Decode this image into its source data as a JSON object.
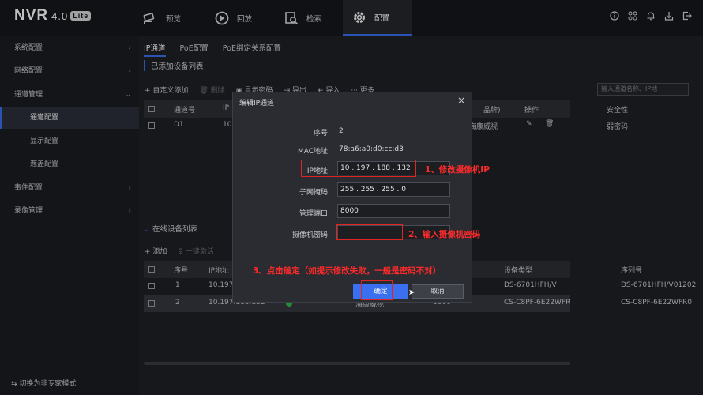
{
  "app": {
    "name": "NVR",
    "version": "4.0",
    "edition": "Lite"
  },
  "nav": [
    {
      "label": "预览",
      "icon": "camera-icon"
    },
    {
      "label": "回放",
      "icon": "playback-icon"
    },
    {
      "label": "检索",
      "icon": "search-icon"
    },
    {
      "label": "配置",
      "icon": "gear-icon",
      "active": true
    }
  ],
  "top_icons": [
    "info-icon",
    "apps-icon",
    "bell-icon",
    "download-icon",
    "logout-icon"
  ],
  "sidebar": {
    "items": [
      {
        "label": "系统配置",
        "arrow": "›"
      },
      {
        "label": "网络配置",
        "arrow": "›"
      },
      {
        "label": "通道管理",
        "arrow": "⌄"
      },
      {
        "label": "通道配置",
        "sub": true,
        "active": true
      },
      {
        "label": "显示配置",
        "sub": true
      },
      {
        "label": "遮盖配置",
        "sub": true
      },
      {
        "label": "事件配置",
        "arrow": "›"
      },
      {
        "label": "录像管理",
        "arrow": "›"
      }
    ],
    "footer": "切换为非专家模式"
  },
  "tabs": [
    "IP通道",
    "PoE配置",
    "PoE绑定关系配置"
  ],
  "added": {
    "title": "已添加设备列表",
    "toolbar": {
      "custom_add": "+ 自定义添加",
      "delete": "删除",
      "show_password": "显示密码",
      "export": "导出",
      "import": "导入",
      "more": "··· 更多"
    },
    "search_placeholder": "输入通道名称、IP地",
    "headers": {
      "channel": "通道号",
      "ip": "IP",
      "brand": "品牌)",
      "ops": "操作",
      "security": "安全性"
    },
    "rows": [
      {
        "channel": "D1",
        "ip": "10",
        "brand": "海康威视",
        "security": "弱密码"
      }
    ]
  },
  "online": {
    "title": "在线设备列表",
    "toolbar": {
      "add": "+ 添加",
      "activate": "一键激活"
    },
    "headers": {
      "no": "序号",
      "ip": "IP地址",
      "type": "设备类型",
      "serial": "序列号"
    },
    "rows": [
      {
        "no": "1",
        "ip": "10.197",
        "type": "DS-6701HFH/V",
        "serial": "DS-6701HFH/V01202"
      },
      {
        "no": "2",
        "ip": "10.197.188.132",
        "type": "CS-C8PF-6E22WFR",
        "serial": "CS-C8PF-6E22WFR0",
        "vendor": "海康威视",
        "port": "8000"
      }
    ]
  },
  "dialog": {
    "title": "编辑IP通道",
    "fields": {
      "seq_label": "序号",
      "seq_value": "2",
      "mac_label": "MAC地址",
      "mac_value": "78:a6:a0:d0:cc:d3",
      "ip_label": "IP地址",
      "ip_value": "10  .  197  .  188  .  132",
      "mask_label": "子网掩码",
      "mask_value": "255  .  255  .  255  .  0",
      "port_label": "管理端口",
      "port_value": "8000",
      "pwd_label": "摄像机密码",
      "pwd_value": ""
    },
    "ok": "确定",
    "cancel": "取消"
  },
  "annotations": {
    "step1": "1、修改摄像机IP",
    "step2": "2、输入摄像机密码",
    "step3": "3、点击确定（如提示修改失败，一般是密码不对）"
  },
  "colors": {
    "accent": "#3a6ff0",
    "annotation": "#ff2a2a",
    "online": "#2fbf4a"
  }
}
